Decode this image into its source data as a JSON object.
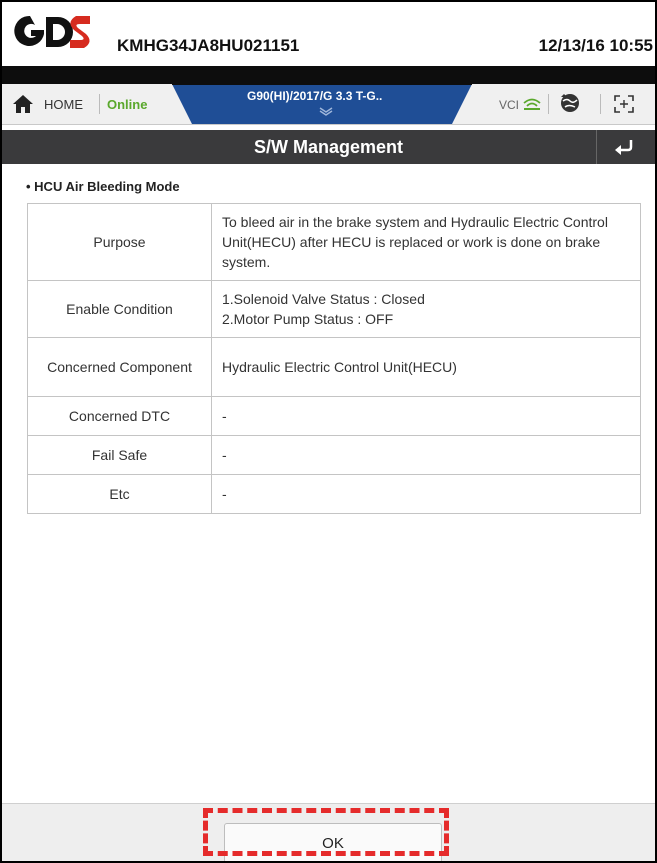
{
  "header": {
    "vin": "KMHG34JA8HU021151",
    "datetime": "12/13/16 10:55"
  },
  "nav": {
    "home_label": "HOME",
    "status": "Online",
    "vehicle": "G90(HI)/2017/G 3.3 T-G..",
    "vci_label": "VCI"
  },
  "title": "S/W Management",
  "section_title": "• HCU Air Bleeding Mode",
  "table": {
    "purpose": {
      "label": "Purpose",
      "value": "To bleed air in the brake system and Hydraulic Electric Control Unit(HECU) after HECU is replaced or work is done on brake system."
    },
    "enable": {
      "label": "Enable Condition",
      "line1": "1.Solenoid Valve Status : Closed",
      "line2": "2.Motor Pump Status : OFF"
    },
    "component": {
      "label": "Concerned Component",
      "value": "Hydraulic Electric Control Unit(HECU)"
    },
    "dtc": {
      "label": "Concerned DTC",
      "value": "-"
    },
    "failsafe": {
      "label": "Fail Safe",
      "value": "-"
    },
    "etc": {
      "label": "Etc",
      "value": "-"
    }
  },
  "footer": {
    "ok_label": "OK"
  },
  "colors": {
    "accent_orange": "#e8822a",
    "online_green": "#5aa82c",
    "title_bar": "#3a3a3c",
    "nav_blue": "#1f4e96",
    "highlight_red": "#e52b2b"
  },
  "icons": [
    "gds-logo",
    "home-icon",
    "wifi-icon",
    "globe-icon",
    "fullscreen-icon",
    "back-icon",
    "chevron-down-icon"
  ]
}
